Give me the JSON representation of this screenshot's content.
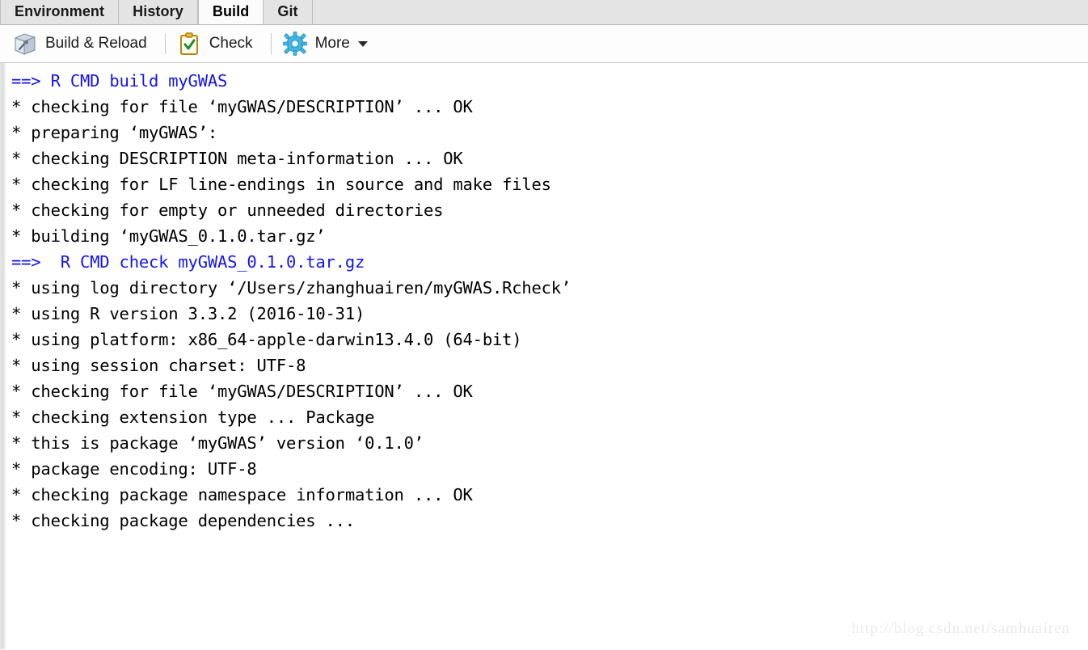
{
  "tabs": [
    {
      "label": "Environment",
      "active": false
    },
    {
      "label": "History",
      "active": false
    },
    {
      "label": "Build",
      "active": true
    },
    {
      "label": "Git",
      "active": false
    }
  ],
  "toolbar": {
    "build_reload_label": "Build & Reload",
    "check_label": "Check",
    "more_label": "More",
    "icons": {
      "build": "build-package-icon",
      "check": "clipboard-check-icon",
      "more": "gear-icon",
      "caret": "chevron-down-icon"
    }
  },
  "console": {
    "lines": [
      {
        "text": "==> R CMD build myGWAS",
        "type": "command"
      },
      {
        "text": "",
        "type": "blank"
      },
      {
        "text": "* checking for file ‘myGWAS/DESCRIPTION’ ... OK",
        "type": "output"
      },
      {
        "text": "* preparing ‘myGWAS’:",
        "type": "output"
      },
      {
        "text": "* checking DESCRIPTION meta-information ... OK",
        "type": "output"
      },
      {
        "text": "* checking for LF line-endings in source and make files",
        "type": "output"
      },
      {
        "text": "* checking for empty or unneeded directories",
        "type": "output"
      },
      {
        "text": "* building ‘myGWAS_0.1.0.tar.gz’",
        "type": "output"
      },
      {
        "text": "",
        "type": "blank"
      },
      {
        "text": "==>  R CMD check myGWAS_0.1.0.tar.gz",
        "type": "command"
      },
      {
        "text": "",
        "type": "blank"
      },
      {
        "text": "* using log directory ‘/Users/zhanghuairen/myGWAS.Rcheck’",
        "type": "output"
      },
      {
        "text": "* using R version 3.3.2 (2016-10-31)",
        "type": "output"
      },
      {
        "text": "* using platform: x86_64-apple-darwin13.4.0 (64-bit)",
        "type": "output"
      },
      {
        "text": "* using session charset: UTF-8",
        "type": "output"
      },
      {
        "text": "* checking for file ‘myGWAS/DESCRIPTION’ ... OK",
        "type": "output"
      },
      {
        "text": "* checking extension type ... Package",
        "type": "output"
      },
      {
        "text": "* this is package ‘myGWAS’ version ‘0.1.0’",
        "type": "output"
      },
      {
        "text": "* package encoding: UTF-8",
        "type": "output"
      },
      {
        "text": "* checking package namespace information ... OK",
        "type": "output"
      },
      {
        "text": "* checking package dependencies ...",
        "type": "output"
      }
    ]
  },
  "watermark": {
    "text": "http://blog.csdn.net/samhuairen"
  },
  "colors": {
    "command_blue": "#1414f0",
    "output_black": "#000000",
    "tabbar_bg": "#e4e4e4",
    "active_tab_bg": "#fbfbfb",
    "toolbar_bg": "#fdfdfd",
    "watermark_gray": "#e9e9e9"
  }
}
